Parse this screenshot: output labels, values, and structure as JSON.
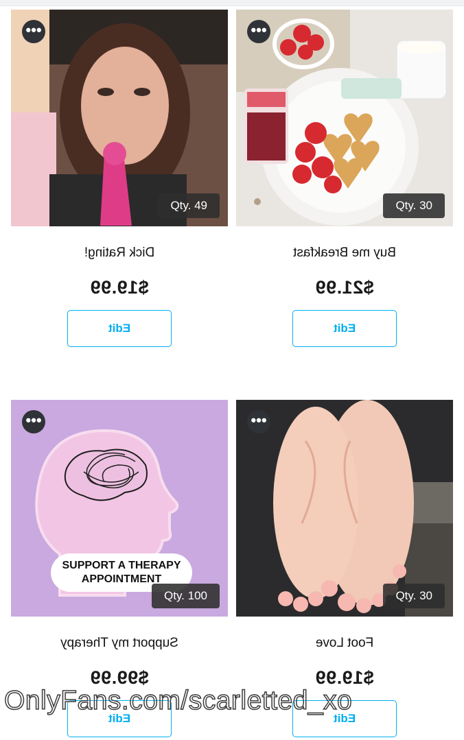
{
  "products": [
    {
      "title": "Buy me Breakfast",
      "price": "$21.99",
      "qty": "Qty. 30",
      "edit_label": "Edit",
      "more": "•••"
    },
    {
      "title": "Dick Rating!",
      "price": "$19.99",
      "qty": "Qty. 49",
      "edit_label": "Edit",
      "more": "•••"
    },
    {
      "title": "Foot Love",
      "price": "$19.99",
      "qty": "Qty. 30",
      "edit_label": "Edit",
      "more": "•••"
    },
    {
      "title": "Support my Therapy",
      "price": "$99.99",
      "qty": "Qty. 100",
      "edit_label": "Edit",
      "more": "•••",
      "image_text": [
        "SUPPORT A THERAPY",
        "APPOINTMENT"
      ]
    }
  ],
  "watermark": "OnlyFans.com/scarletted_xo",
  "colors": {
    "accent": "#00aff0",
    "badge_bg": "#2d2d2d",
    "therapy_bg": "#c9a9df"
  },
  "icons": {
    "more": "more-options-icon"
  }
}
